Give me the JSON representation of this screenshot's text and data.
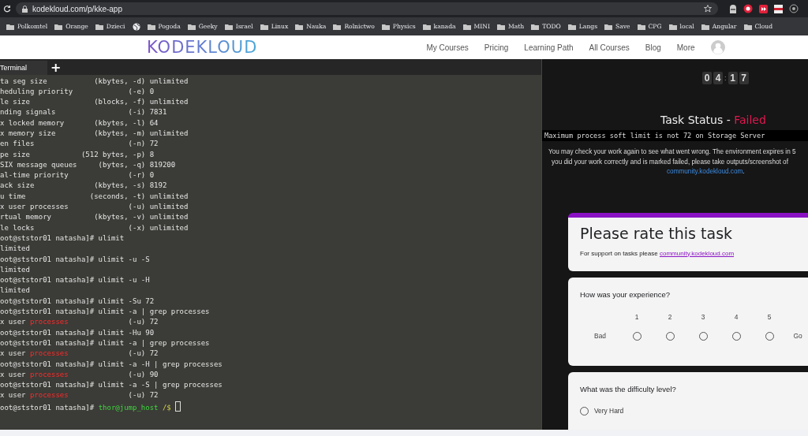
{
  "browser": {
    "url": "kodekloud.com/p/kke-app",
    "bookmarks": [
      {
        "kind": "folder",
        "label": "Polkomtel"
      },
      {
        "kind": "folder",
        "label": "Orange"
      },
      {
        "kind": "folder",
        "label": "Dzieci"
      },
      {
        "kind": "site"
      },
      {
        "kind": "folder",
        "label": "Pogoda"
      },
      {
        "kind": "folder",
        "label": "Geeky"
      },
      {
        "kind": "folder",
        "label": "Israel"
      },
      {
        "kind": "folder",
        "label": "Linux"
      },
      {
        "kind": "folder",
        "label": "Nauka"
      },
      {
        "kind": "folder",
        "label": "Rolnictwo"
      },
      {
        "kind": "folder",
        "label": "Physics"
      },
      {
        "kind": "folder",
        "label": "kanada"
      },
      {
        "kind": "folder",
        "label": "MINI"
      },
      {
        "kind": "folder",
        "label": "Math"
      },
      {
        "kind": "folder",
        "label": "TODO"
      },
      {
        "kind": "folder",
        "label": "Langs"
      },
      {
        "kind": "folder",
        "label": "Save"
      },
      {
        "kind": "folder",
        "label": "CPG"
      },
      {
        "kind": "folder",
        "label": "local"
      },
      {
        "kind": "folder",
        "label": "Angular"
      },
      {
        "kind": "folder",
        "label": "Cloud"
      }
    ]
  },
  "site_header": {
    "logo": "KODEKLOUD",
    "nav": [
      "My Courses",
      "Pricing",
      "Learning Path",
      "All Courses",
      "Blog",
      "More"
    ]
  },
  "terminal": {
    "tabs": [
      {
        "label": "Terminal",
        "selected": true
      }
    ],
    "new_tab_button": "+",
    "cursor": true,
    "lines": [
      [
        {
          "kind": "plain",
          "text": "ta seg size           (kbytes, -d) unlimited"
        }
      ],
      [
        {
          "kind": "plain",
          "text": "heduling priority             (-e) 0"
        }
      ],
      [
        {
          "kind": "plain",
          "text": "le size               (blocks, -f) unlimited"
        }
      ],
      [
        {
          "kind": "plain",
          "text": "nding signals                 (-i) 7831"
        }
      ],
      [
        {
          "kind": "plain",
          "text": "x locked memory       (kbytes, -l) 64"
        }
      ],
      [
        {
          "kind": "plain",
          "text": "x memory size         (kbytes, -m) unlimited"
        }
      ],
      [
        {
          "kind": "plain",
          "text": "en files                      (-n) 72"
        }
      ],
      [
        {
          "kind": "plain",
          "text": "pe size            (512 bytes, -p) 8"
        }
      ],
      [
        {
          "kind": "plain",
          "text": "SIX message queues     (bytes, -q) 819200"
        }
      ],
      [
        {
          "kind": "plain",
          "text": "al-time priority              (-r) 0"
        }
      ],
      [
        {
          "kind": "plain",
          "text": "ack size              (kbytes, -s) 8192"
        }
      ],
      [
        {
          "kind": "plain",
          "text": "u time               (seconds, -t) unlimited"
        }
      ],
      [
        {
          "kind": "plain",
          "text": "x user processes              (-u) unlimited"
        }
      ],
      [
        {
          "kind": "plain",
          "text": "rtual memory          (kbytes, -v) unlimited"
        }
      ],
      [
        {
          "kind": "plain",
          "text": "le locks                      (-x) unlimited"
        }
      ],
      [
        {
          "kind": "plain",
          "text": "oot@ststor01 natasha]# ulimit"
        }
      ],
      [
        {
          "kind": "plain",
          "text": "limited"
        }
      ],
      [
        {
          "kind": "plain",
          "text": "oot@ststor01 natasha]# ulimit -u -S"
        }
      ],
      [
        {
          "kind": "plain",
          "text": "limited"
        }
      ],
      [
        {
          "kind": "plain",
          "text": "oot@ststor01 natasha]# ulimit -u -H"
        }
      ],
      [
        {
          "kind": "plain",
          "text": "limited"
        }
      ],
      [
        {
          "kind": "plain",
          "text": "oot@ststor01 natasha]# ulimit -Su 72"
        }
      ],
      [
        {
          "kind": "plain",
          "text": "oot@ststor01 natasha]# ulimit -a | grep processes"
        }
      ],
      [
        {
          "kind": "plain",
          "text": "x user "
        },
        {
          "kind": "match",
          "text": "processes"
        },
        {
          "kind": "plain",
          "text": "              (-u) 72"
        }
      ],
      [
        {
          "kind": "plain",
          "text": "oot@ststor01 natasha]# ulimit -Hu 90"
        }
      ],
      [
        {
          "kind": "plain",
          "text": "oot@ststor01 natasha]# ulimit -a | grep processes"
        }
      ],
      [
        {
          "kind": "plain",
          "text": "x user "
        },
        {
          "kind": "match",
          "text": "processes"
        },
        {
          "kind": "plain",
          "text": "              (-u) 72"
        }
      ],
      [
        {
          "kind": "plain",
          "text": "oot@ststor01 natasha]# ulimit -a -H | grep processes"
        }
      ],
      [
        {
          "kind": "plain",
          "text": "x user "
        },
        {
          "kind": "match",
          "text": "processes"
        },
        {
          "kind": "plain",
          "text": "              (-u) 90"
        }
      ],
      [
        {
          "kind": "plain",
          "text": "oot@ststor01 natasha]# ulimit -a -S | grep processes"
        }
      ],
      [
        {
          "kind": "plain",
          "text": "x user "
        },
        {
          "kind": "match",
          "text": "processes"
        },
        {
          "kind": "plain",
          "text": "              (-u) 72"
        }
      ],
      [
        {
          "kind": "plain",
          "text": "oot@ststor01 natasha]# "
        },
        {
          "kind": "user",
          "text": "thor@jump_host"
        },
        {
          "kind": "path",
          "text": " /$ "
        }
      ]
    ]
  },
  "task_panel": {
    "timer": {
      "minutes": [
        "0",
        "4"
      ],
      "separator": ":",
      "seconds": [
        "1",
        "7"
      ]
    },
    "status_label": "Task Status - ",
    "status": "Failed",
    "message": "Maximum process soft limit is not 72 on Storage Server",
    "info_lines": [
      "You may check your work again to see what went wrong. The environment expires in 5",
      "you did your work correctly and is marked failed, please take outputs/screenshot of"
    ],
    "info_link": "community.kodekloud.com",
    "info_end": ".",
    "form": {
      "title": "Please rate this task",
      "support_text": "For support on tasks please ",
      "support_link": "community.kodekloud.com",
      "experience": {
        "question": "How was your experience?",
        "low_label": "Bad",
        "high_label": "Go",
        "options": [
          {
            "label": "1",
            "selected": false
          },
          {
            "label": "2",
            "selected": false
          },
          {
            "label": "3",
            "selected": false
          },
          {
            "label": "4",
            "selected": false
          },
          {
            "label": "5",
            "selected": false
          }
        ]
      },
      "difficulty": {
        "question": "What was the difficulty level?",
        "options": [
          {
            "label": "Very Hard",
            "selected": false
          }
        ]
      }
    }
  }
}
